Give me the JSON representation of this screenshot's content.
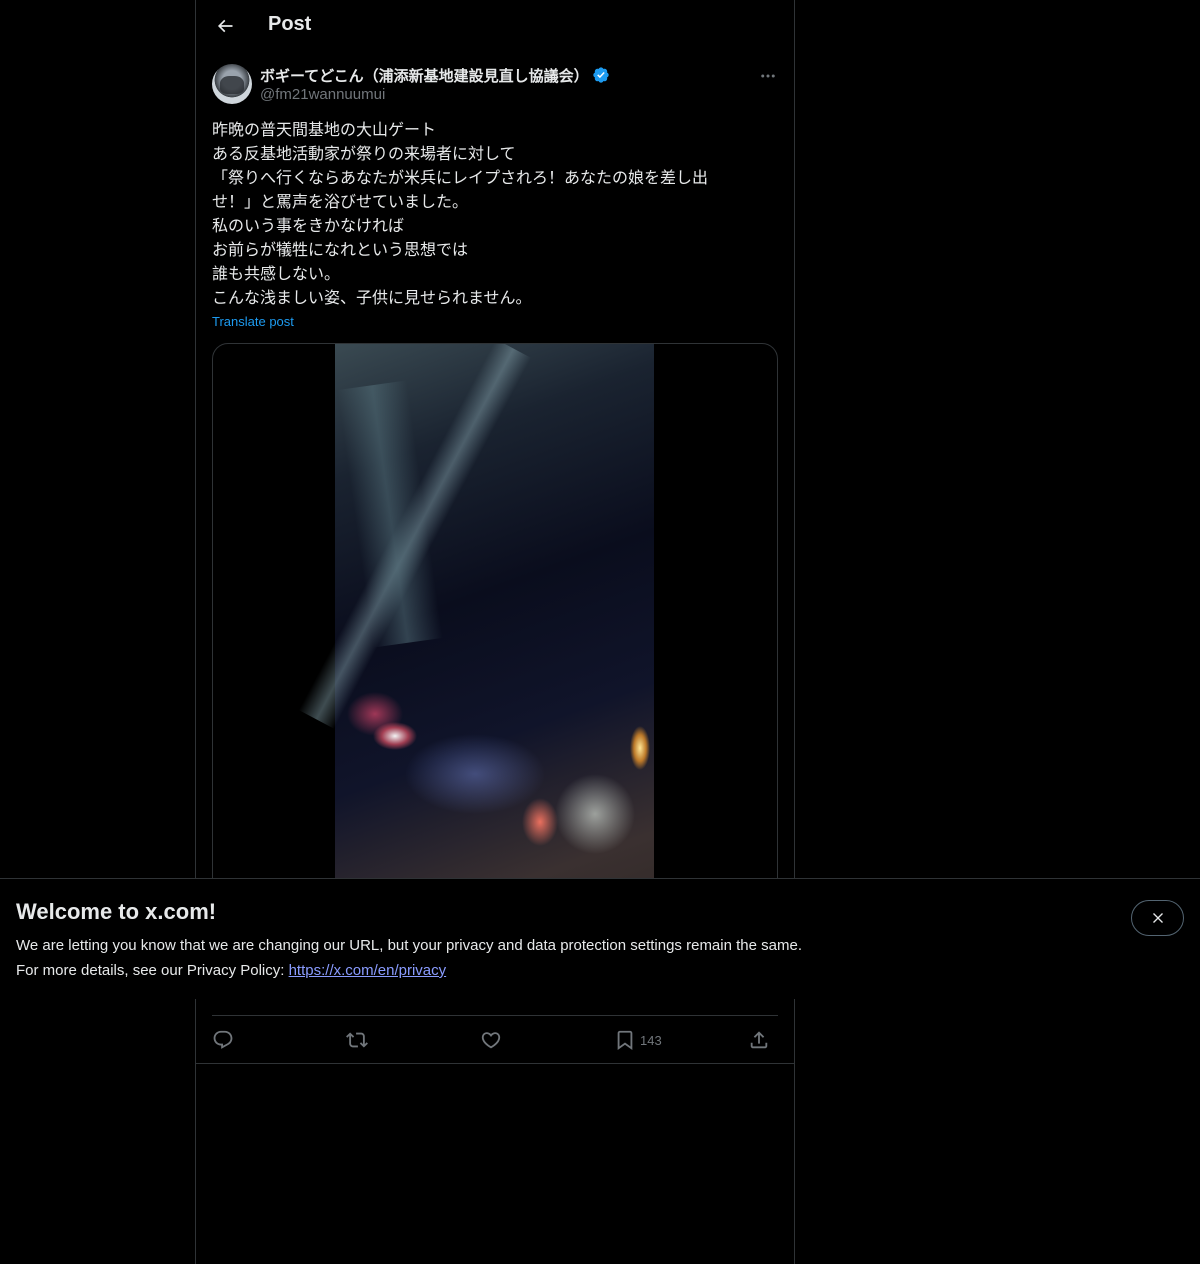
{
  "header": {
    "title": "Post",
    "back_icon": "arrow-left-icon"
  },
  "post": {
    "author": {
      "display_name": "ボギーてどこん（浦添新基地建設見直し協議会）",
      "handle": "@fm21wannuumui",
      "verified": true,
      "verified_color": "#1d9bf0"
    },
    "text_lines": [
      "昨晩の普天間基地の大山ゲート",
      "ある反基地活動家が祭りの来場者に対して",
      "「祭りへ行くならあなたが米兵にレイプされろ！あなたの娘を差し出",
      "せ！」と罵声を浴びせていました。",
      "私のいう事をきかなければ",
      "お前らが犠牲になれという思想では",
      "誰も共感しない。",
      "こんな浅ましい姿、子供に見せられません。"
    ],
    "translate_label": "Translate post",
    "actions": {
      "reply_icon": "reply-icon",
      "repost_icon": "repost-icon",
      "like_icon": "like-icon",
      "bookmark_icon": "bookmark-icon",
      "bookmark_count": "143",
      "share_icon": "share-icon"
    }
  },
  "banner": {
    "title": "Welcome to x.com!",
    "line1": "We are letting you know that we are changing our URL, but your privacy and data protection settings remain the same.",
    "line2_prefix": "For more details, see our Privacy Policy: ",
    "link_text": "https://x.com/en/privacy",
    "close_icon": "close-icon"
  },
  "colors": {
    "background": "#000000",
    "text": "#e7e9ea",
    "muted": "#71767b",
    "accent": "#1d9bf0",
    "link": "#8a9cff",
    "border": "#2f3336"
  }
}
